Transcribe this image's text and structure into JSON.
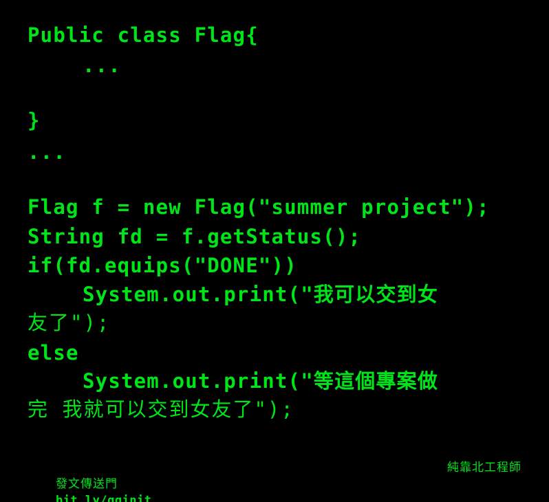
{
  "colors": {
    "background": "#000000",
    "text": "#00e51a"
  },
  "code": {
    "lines": [
      "Public class Flag{",
      "...",
      "}",
      "...",
      "Flag f = new Flag(\"summer project\");",
      "String fd = f.getStatus();",
      "if(fd.equips(\"DONE\"))",
      "System.out.print(\"我可以交到女",
      "友了\");",
      "else",
      "System.out.print(\"等這個專案做",
      "完 我就可以交到女友了\");"
    ]
  },
  "footer": {
    "left_label": "發文傳送門",
    "left_link": "bit.ly/gginit",
    "right_label": "純靠北工程師"
  }
}
